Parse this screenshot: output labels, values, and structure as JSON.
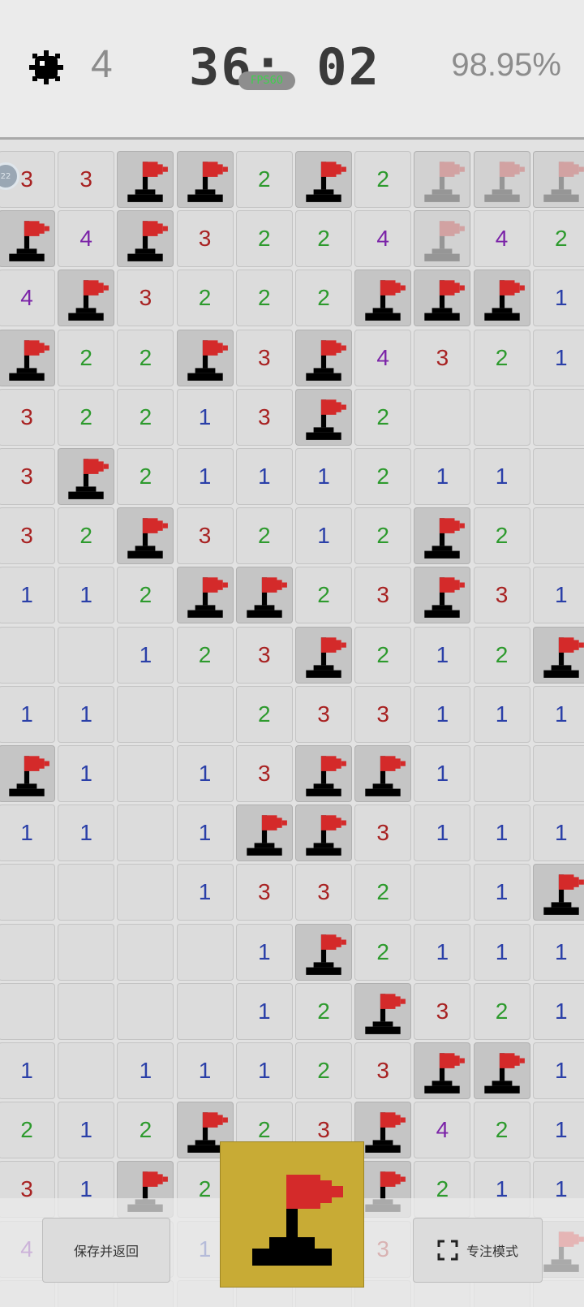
{
  "header": {
    "mines_remaining": "4",
    "timer": "36: 02",
    "fps_label": "FPS60",
    "progress_percent": "98.95%"
  },
  "avatar_badge": "22",
  "board": {
    "columns_visible": 10,
    "rows": [
      [
        "3",
        "3",
        "F",
        "F",
        "2",
        "F",
        "2",
        "f",
        "f",
        "f"
      ],
      [
        "F",
        "4",
        "F",
        "3",
        "2",
        "2",
        "4",
        "f",
        "4",
        "2"
      ],
      [
        "4",
        "F",
        "3",
        "2",
        "2",
        "2",
        "F",
        "F",
        "F",
        "1"
      ],
      [
        "F",
        "2",
        "2",
        "F",
        "3",
        "F",
        "4",
        "3",
        "2",
        "1"
      ],
      [
        "3",
        "2",
        "2",
        "1",
        "3",
        "F",
        "2",
        "",
        "",
        ""
      ],
      [
        "3",
        "F",
        "2",
        "1",
        "1",
        "1",
        "2",
        "1",
        "1",
        ""
      ],
      [
        "3",
        "2",
        "F",
        "3",
        "2",
        "1",
        "2",
        "F",
        "2",
        ""
      ],
      [
        "1",
        "1",
        "2",
        "F",
        "F",
        "2",
        "3",
        "F",
        "3",
        "1"
      ],
      [
        "",
        "",
        "1",
        "2",
        "3",
        "F",
        "2",
        "1",
        "2",
        "F"
      ],
      [
        "1",
        "1",
        "",
        "",
        "2",
        "3",
        "3",
        "1",
        "1",
        "1"
      ],
      [
        "F",
        "1",
        "",
        "1",
        "3",
        "F",
        "F",
        "1",
        "",
        ""
      ],
      [
        "1",
        "1",
        "",
        "1",
        "F",
        "F",
        "3",
        "1",
        "1",
        "1"
      ],
      [
        "",
        "",
        "",
        "1",
        "3",
        "3",
        "2",
        "",
        "1",
        "F"
      ],
      [
        "",
        "",
        "",
        "",
        "1",
        "F",
        "2",
        "1",
        "1",
        "1"
      ],
      [
        "",
        "",
        "",
        "",
        "1",
        "2",
        "F",
        "3",
        "2",
        "1"
      ],
      [
        "1",
        "",
        "1",
        "1",
        "1",
        "2",
        "3",
        "F",
        "F",
        "1"
      ],
      [
        "2",
        "1",
        "2",
        "F",
        "2",
        "3",
        "F",
        "4",
        "2",
        "1"
      ],
      [
        "3",
        "1",
        "F",
        "2",
        "",
        "",
        "F",
        "2",
        "1",
        "1"
      ],
      [
        "4",
        "",
        "",
        "1",
        "",
        "",
        "3",
        "",
        "",
        "F"
      ],
      [
        "",
        "",
        "",
        "",
        "",
        "",
        "",
        "",
        "",
        ""
      ]
    ]
  },
  "controls": {
    "save_label": "保存并返回",
    "focus_label": "专注模式",
    "mode_icon": "flag-icon"
  },
  "colors": {
    "n1": "#2a3fa8",
    "n2": "#2d9a2d",
    "n3": "#a82222",
    "n4": "#7b23a8",
    "flag_red": "#d42a2a",
    "toggle_bg": "#c8ab35"
  }
}
